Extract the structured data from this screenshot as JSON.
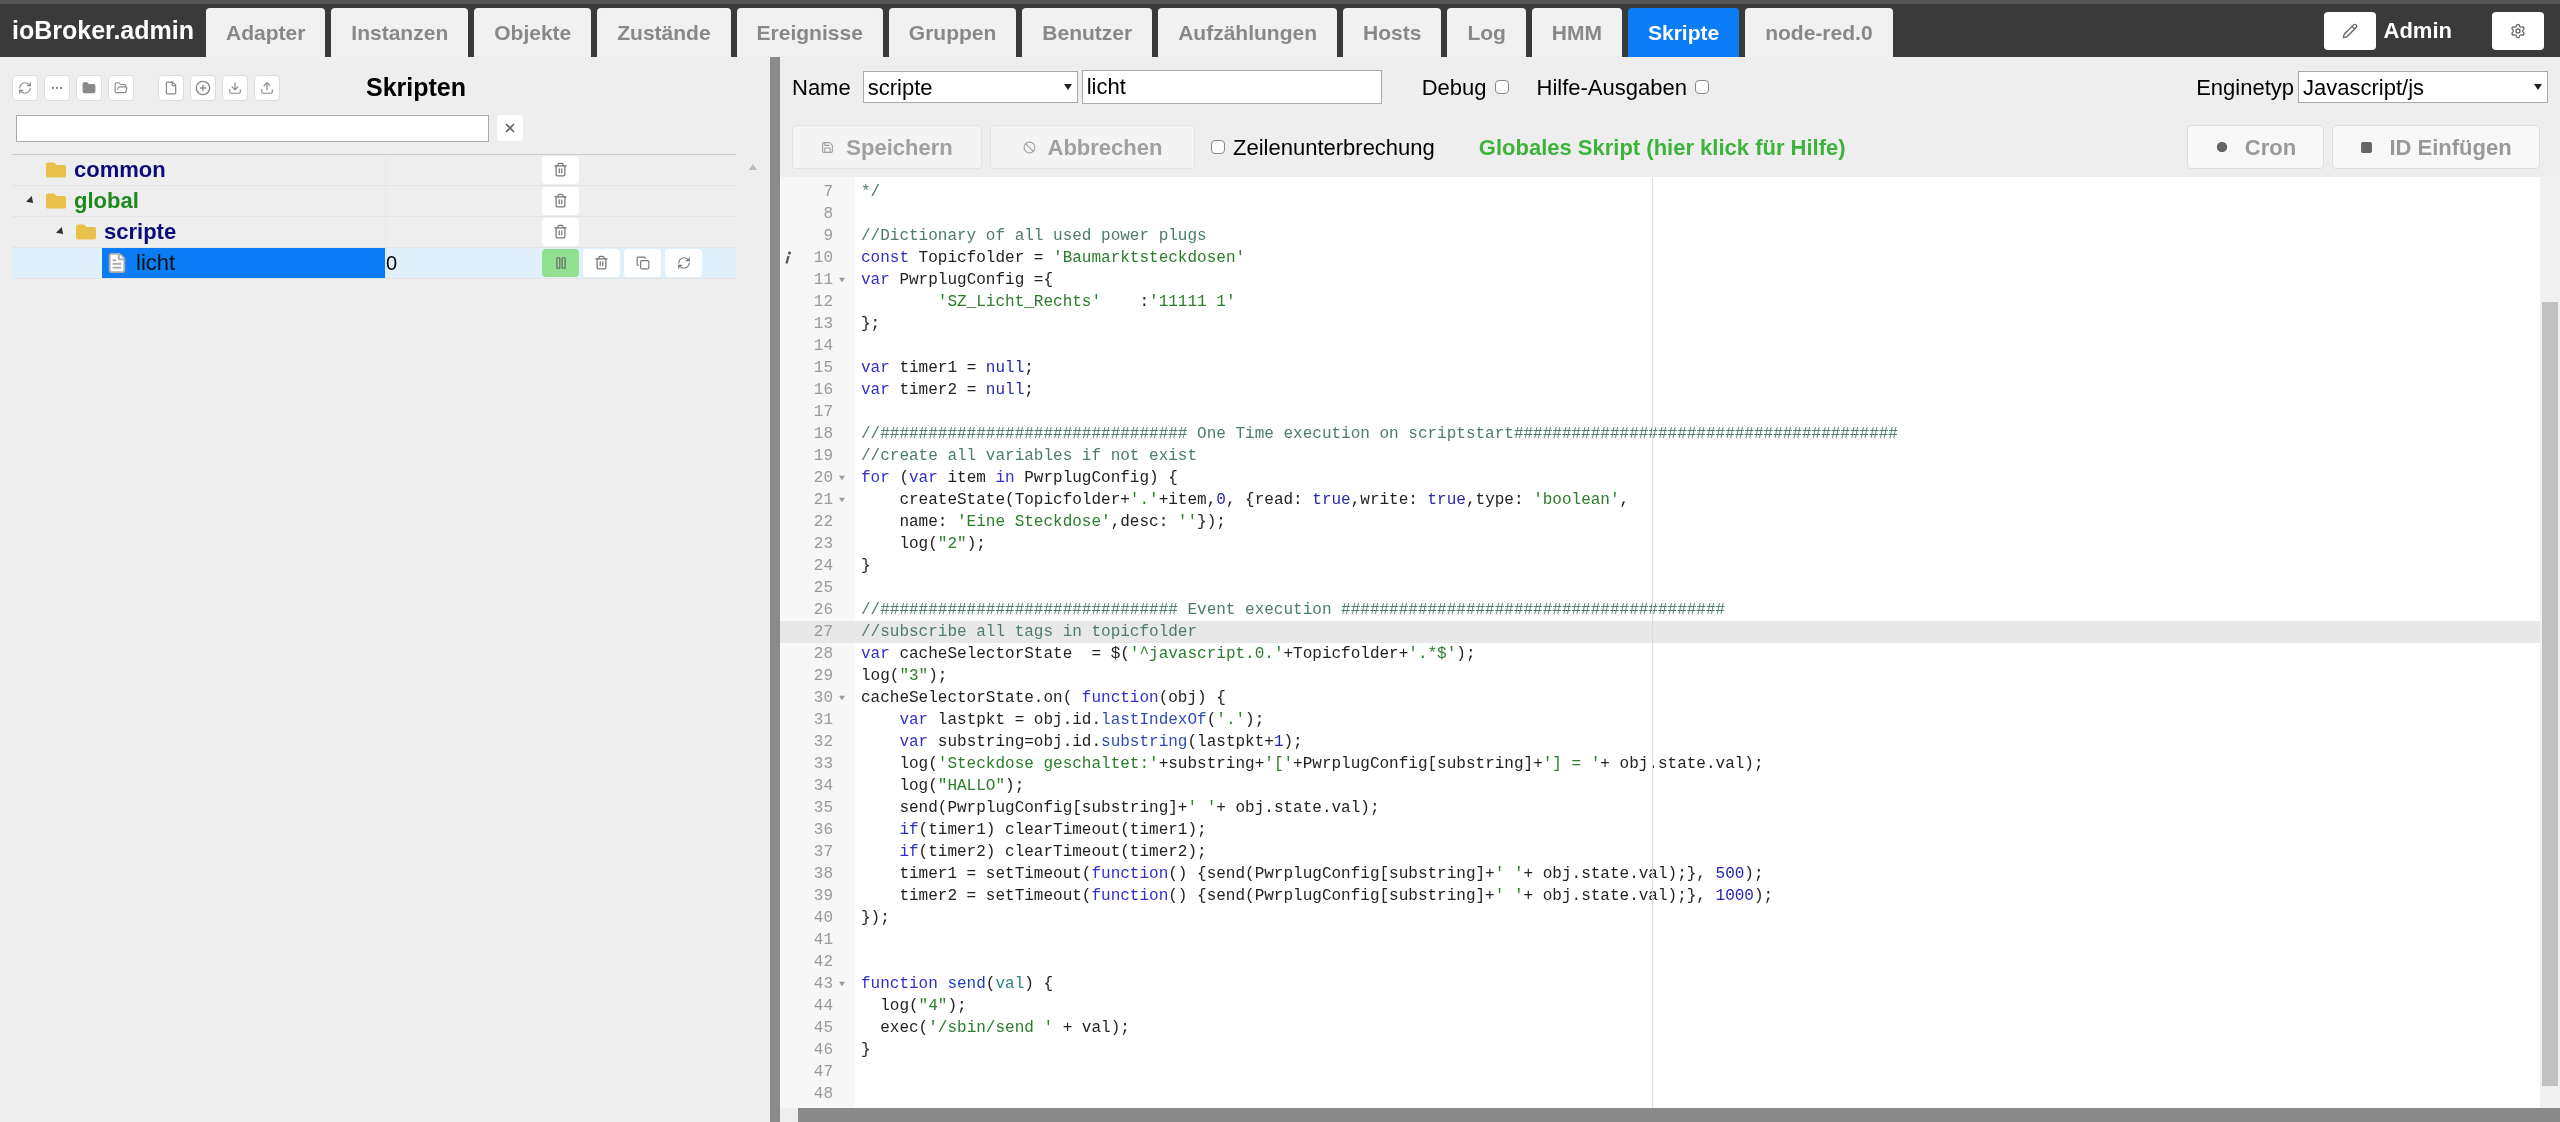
{
  "header": {
    "brand": "ioBroker.admin",
    "tabs": [
      {
        "label": "Adapter",
        "selected": false
      },
      {
        "label": "Instanzen",
        "selected": false
      },
      {
        "label": "Objekte",
        "selected": false
      },
      {
        "label": "Zustände",
        "selected": false
      },
      {
        "label": "Ereignisse",
        "selected": false
      },
      {
        "label": "Gruppen",
        "selected": false
      },
      {
        "label": "Benutzer",
        "selected": false
      },
      {
        "label": "Aufzählungen",
        "selected": false
      },
      {
        "label": "Hosts",
        "selected": false
      },
      {
        "label": "Log",
        "selected": false
      },
      {
        "label": "HMM",
        "selected": false
      },
      {
        "label": "Skripte",
        "selected": true
      },
      {
        "label": "node-red.0",
        "selected": false
      }
    ],
    "user": "Admin"
  },
  "sidebar": {
    "title": "Skripten",
    "tree": [
      {
        "name": "common",
        "kind": "folder",
        "color": "#0b0b7a",
        "selected": false
      },
      {
        "name": "global",
        "kind": "folder",
        "color": "#1e8a1e",
        "expanded": true,
        "selected": false,
        "children": [
          {
            "name": "scripte",
            "kind": "folder",
            "color": "#0b0b7a",
            "expanded": true,
            "selected": false,
            "children": [
              {
                "name": "licht",
                "kind": "script",
                "value": "0",
                "running": true,
                "selected": true
              }
            ]
          }
        ]
      }
    ]
  },
  "editor": {
    "name_label": "Name",
    "folder": "scripte",
    "name": "licht",
    "debug_label": "Debug",
    "debug": false,
    "help_label": "Hilfe-Ausgaben",
    "help": false,
    "engine_label": "Enginetyp",
    "engine": "Javascript/js",
    "save": {
      "label": "Speichern",
      "disabled": true
    },
    "cancel": {
      "label": "Abbrechen",
      "disabled": true
    },
    "wrap_label": "Zeilenunterbrechung",
    "wrap": false,
    "help_link": "Globales Skript (hier klick für Hilfe)",
    "cron": "Cron",
    "insert_id": "ID Einfügen",
    "lines": [
      {
        "n": "7",
        "fold": false,
        "active": false,
        "info": false,
        "tokens": [
          {
            "kind": "cmt",
            "text": "*/"
          }
        ]
      },
      {
        "n": "8",
        "fold": false,
        "active": false,
        "info": false
      },
      {
        "n": "9",
        "fold": false,
        "active": false,
        "info": false,
        "tokens": [
          {
            "kind": "cmt",
            "text": "//Dictionary of all used power plugs"
          }
        ]
      },
      {
        "n": "10",
        "fold": false,
        "active": false,
        "info": true,
        "tokens": [
          {
            "kind": "kw",
            "text": "const"
          },
          {
            "kind": "plain",
            "text": " Topicfolder = "
          },
          {
            "kind": "str",
            "text": "'Baumarktsteckdosen'"
          }
        ]
      },
      {
        "n": "11",
        "fold": true,
        "active": false,
        "info": false,
        "tokens": [
          {
            "kind": "kw",
            "text": "var"
          },
          {
            "kind": "plain",
            "text": " PwrplugConfig ={"
          }
        ]
      },
      {
        "n": "12",
        "fold": false,
        "active": false,
        "info": false,
        "tokens": [
          {
            "kind": "str",
            "text": "        'SZ_Licht_Rechts'"
          },
          {
            "kind": "plain",
            "text": "    :"
          },
          {
            "kind": "str",
            "text": "'11111 1'"
          }
        ]
      },
      {
        "n": "13",
        "fold": false,
        "active": false,
        "info": false,
        "tokens": [
          {
            "kind": "plain",
            "text": "};"
          }
        ]
      },
      {
        "n": "14",
        "fold": false,
        "active": false,
        "info": false
      },
      {
        "n": "15",
        "fold": false,
        "active": false,
        "info": false,
        "tokens": [
          {
            "kind": "kw",
            "text": "var"
          },
          {
            "kind": "plain",
            "text": " timer1 = "
          },
          {
            "kind": "atom",
            "text": "null"
          },
          {
            "kind": "plain",
            "text": ";"
          }
        ]
      },
      {
        "n": "16",
        "fold": false,
        "active": false,
        "info": false,
        "tokens": [
          {
            "kind": "kw",
            "text": "var"
          },
          {
            "kind": "plain",
            "text": " timer2 = "
          },
          {
            "kind": "atom",
            "text": "null"
          },
          {
            "kind": "plain",
            "text": ";"
          }
        ]
      },
      {
        "n": "17",
        "fold": false,
        "active": false,
        "info": false
      },
      {
        "n": "18",
        "fold": false,
        "active": false,
        "info": false,
        "tokens": [
          {
            "kind": "cmt",
            "text": "//################################ One Time execution on scriptstart########################################"
          }
        ]
      },
      {
        "n": "19",
        "fold": false,
        "active": false,
        "info": false,
        "tokens": [
          {
            "kind": "cmt",
            "text": "//create all variables if not exist"
          }
        ]
      },
      {
        "n": "20",
        "fold": true,
        "active": false,
        "info": false,
        "tokens": [
          {
            "kind": "kw",
            "text": "for"
          },
          {
            "kind": "plain",
            "text": " ("
          },
          {
            "kind": "kw",
            "text": "var"
          },
          {
            "kind": "plain",
            "text": " item "
          },
          {
            "kind": "kw",
            "text": "in"
          },
          {
            "kind": "plain",
            "text": " PwrplugConfig) {"
          }
        ]
      },
      {
        "n": "21",
        "fold": true,
        "active": false,
        "info": false,
        "tokens": [
          {
            "kind": "plain",
            "text": "    createState(Topicfolder+"
          },
          {
            "kind": "str",
            "text": "'.'"
          },
          {
            "kind": "plain",
            "text": "+item,"
          },
          {
            "kind": "num",
            "text": "0"
          },
          {
            "kind": "plain",
            "text": ", {read: "
          },
          {
            "kind": "atom",
            "text": "true"
          },
          {
            "kind": "plain",
            "text": ",write: "
          },
          {
            "kind": "atom",
            "text": "true"
          },
          {
            "kind": "plain",
            "text": ",type: "
          },
          {
            "kind": "str",
            "text": "'boolean'"
          },
          {
            "kind": "plain",
            "text": ","
          }
        ]
      },
      {
        "n": "22",
        "fold": false,
        "active": false,
        "info": false,
        "tokens": [
          {
            "kind": "plain",
            "text": "    name: "
          },
          {
            "kind": "str",
            "text": "'Eine Steckdose'"
          },
          {
            "kind": "plain",
            "text": ",desc: "
          },
          {
            "kind": "str",
            "text": "''"
          },
          {
            "kind": "plain",
            "text": "});"
          }
        ]
      },
      {
        "n": "23",
        "fold": false,
        "active": false,
        "info": false,
        "tokens": [
          {
            "kind": "plain",
            "text": "    log("
          },
          {
            "kind": "str",
            "text": "\"2\""
          },
          {
            "kind": "plain",
            "text": ");"
          }
        ]
      },
      {
        "n": "24",
        "fold": false,
        "active": false,
        "info": false,
        "tokens": [
          {
            "kind": "plain",
            "text": "}"
          }
        ]
      },
      {
        "n": "25",
        "fold": false,
        "active": false,
        "info": false
      },
      {
        "n": "26",
        "fold": false,
        "active": false,
        "info": false,
        "tokens": [
          {
            "kind": "cmt",
            "text": "//############################### Event execution ########################################"
          }
        ]
      },
      {
        "n": "27",
        "fold": false,
        "active": true,
        "info": false,
        "tokens": [
          {
            "kind": "cmt",
            "text": "//subscribe all tags in topicfolder"
          }
        ]
      },
      {
        "n": "28",
        "fold": false,
        "active": false,
        "info": false,
        "tokens": [
          {
            "kind": "kw",
            "text": "var"
          },
          {
            "kind": "plain",
            "text": " cacheSelectorState  = $("
          },
          {
            "kind": "str",
            "text": "'^javascript.0.'"
          },
          {
            "kind": "plain",
            "text": "+Topicfolder+"
          },
          {
            "kind": "str",
            "text": "'.*$'"
          },
          {
            "kind": "plain",
            "text": ");"
          }
        ]
      },
      {
        "n": "29",
        "fold": false,
        "active": false,
        "info": false,
        "tokens": [
          {
            "kind": "plain",
            "text": "log("
          },
          {
            "kind": "str",
            "text": "\"3\""
          },
          {
            "kind": "plain",
            "text": ");"
          }
        ]
      },
      {
        "n": "30",
        "fold": true,
        "active": false,
        "info": false,
        "tokens": [
          {
            "kind": "plain",
            "text": "cacheSelectorState.on( "
          },
          {
            "kind": "kw",
            "text": "function"
          },
          {
            "kind": "plain",
            "text": "(obj) {"
          }
        ]
      },
      {
        "n": "31",
        "fold": false,
        "active": false,
        "info": false,
        "tokens": [
          {
            "kind": "kw",
            "text": "    var"
          },
          {
            "kind": "plain",
            "text": " lastpkt = obj.id."
          },
          {
            "kind": "prop",
            "text": "lastIndexOf"
          },
          {
            "kind": "plain",
            "text": "("
          },
          {
            "kind": "str",
            "text": "'.'"
          },
          {
            "kind": "plain",
            "text": ");"
          }
        ]
      },
      {
        "n": "32",
        "fold": false,
        "active": false,
        "info": false,
        "tokens": [
          {
            "kind": "kw",
            "text": "    var"
          },
          {
            "kind": "plain",
            "text": " substring=obj.id."
          },
          {
            "kind": "prop",
            "text": "substring"
          },
          {
            "kind": "plain",
            "text": "(lastpkt+"
          },
          {
            "kind": "num",
            "text": "1"
          },
          {
            "kind": "plain",
            "text": ");"
          }
        ]
      },
      {
        "n": "33",
        "fold": false,
        "active": false,
        "info": false,
        "tokens": [
          {
            "kind": "plain",
            "text": "    log("
          },
          {
            "kind": "str",
            "text": "'Steckdose geschaltet:'"
          },
          {
            "kind": "plain",
            "text": "+substring+"
          },
          {
            "kind": "str",
            "text": "'['"
          },
          {
            "kind": "plain",
            "text": "+PwrplugConfig[substring]+"
          },
          {
            "kind": "str",
            "text": "'] = '"
          },
          {
            "kind": "plain",
            "text": "+ obj.state.val);"
          }
        ]
      },
      {
        "n": "34",
        "fold": false,
        "active": false,
        "info": false,
        "tokens": [
          {
            "kind": "plain",
            "text": "    log("
          },
          {
            "kind": "str",
            "text": "\"HALLO\""
          },
          {
            "kind": "plain",
            "text": ");"
          }
        ]
      },
      {
        "n": "35",
        "fold": false,
        "active": false,
        "info": false,
        "tokens": [
          {
            "kind": "plain",
            "text": "    send(PwrplugConfig[substring]+"
          },
          {
            "kind": "str",
            "text": "' '"
          },
          {
            "kind": "plain",
            "text": "+ obj.state.val);"
          }
        ]
      },
      {
        "n": "36",
        "fold": false,
        "active": false,
        "info": false,
        "tokens": [
          {
            "kind": "kw",
            "text": "    if"
          },
          {
            "kind": "plain",
            "text": "(timer1) clearTimeout(timer1);"
          }
        ]
      },
      {
        "n": "37",
        "fold": false,
        "active": false,
        "info": false,
        "tokens": [
          {
            "kind": "kw",
            "text": "    if"
          },
          {
            "kind": "plain",
            "text": "(timer2) clearTimeout(timer2);"
          }
        ]
      },
      {
        "n": "38",
        "fold": false,
        "active": false,
        "info": false,
        "tokens": [
          {
            "kind": "plain",
            "text": "    timer1 = setTimeout("
          },
          {
            "kind": "kw",
            "text": "function"
          },
          {
            "kind": "plain",
            "text": "() {send(PwrplugConfig[substring]+"
          },
          {
            "kind": "str",
            "text": "' '"
          },
          {
            "kind": "plain",
            "text": "+ obj.state.val);}, "
          },
          {
            "kind": "num",
            "text": "500"
          },
          {
            "kind": "plain",
            "text": ");"
          }
        ]
      },
      {
        "n": "39",
        "fold": false,
        "active": false,
        "info": false,
        "tokens": [
          {
            "kind": "plain",
            "text": "    timer2 = setTimeout("
          },
          {
            "kind": "kw",
            "text": "function"
          },
          {
            "kind": "plain",
            "text": "() {send(PwrplugConfig[substring]+"
          },
          {
            "kind": "str",
            "text": "' '"
          },
          {
            "kind": "plain",
            "text": "+ obj.state.val);}, "
          },
          {
            "kind": "num",
            "text": "1000"
          },
          {
            "kind": "plain",
            "text": ");"
          }
        ]
      },
      {
        "n": "40",
        "fold": false,
        "active": false,
        "info": false,
        "tokens": [
          {
            "kind": "plain",
            "text": "});"
          }
        ]
      },
      {
        "n": "41",
        "fold": false,
        "active": false,
        "info": false
      },
      {
        "n": "42",
        "fold": false,
        "active": false,
        "info": false
      },
      {
        "n": "43",
        "fold": true,
        "active": false,
        "info": false,
        "tokens": [
          {
            "kind": "kw",
            "text": "function"
          },
          {
            "kind": "def",
            "text": " send"
          },
          {
            "kind": "plain",
            "text": "("
          },
          {
            "kind": "param",
            "text": "val"
          },
          {
            "kind": "plain",
            "text": ") {"
          }
        ]
      },
      {
        "n": "44",
        "fold": false,
        "active": false,
        "info": false,
        "tokens": [
          {
            "kind": "plain",
            "text": "  log("
          },
          {
            "kind": "str",
            "text": "\"4\""
          },
          {
            "kind": "plain",
            "text": ");"
          }
        ]
      },
      {
        "n": "45",
        "fold": false,
        "active": false,
        "info": false,
        "tokens": [
          {
            "kind": "plain",
            "text": "  exec("
          },
          {
            "kind": "str",
            "text": "'/sbin/send '"
          },
          {
            "kind": "plain",
            "text": " + val);"
          }
        ]
      },
      {
        "n": "46",
        "fold": false,
        "active": false,
        "info": false,
        "tokens": [
          {
            "kind": "plain",
            "text": "}"
          }
        ]
      },
      {
        "n": "47",
        "fold": false,
        "active": false,
        "info": false
      },
      {
        "n": "48",
        "fold": false,
        "active": false,
        "info": false
      }
    ]
  }
}
